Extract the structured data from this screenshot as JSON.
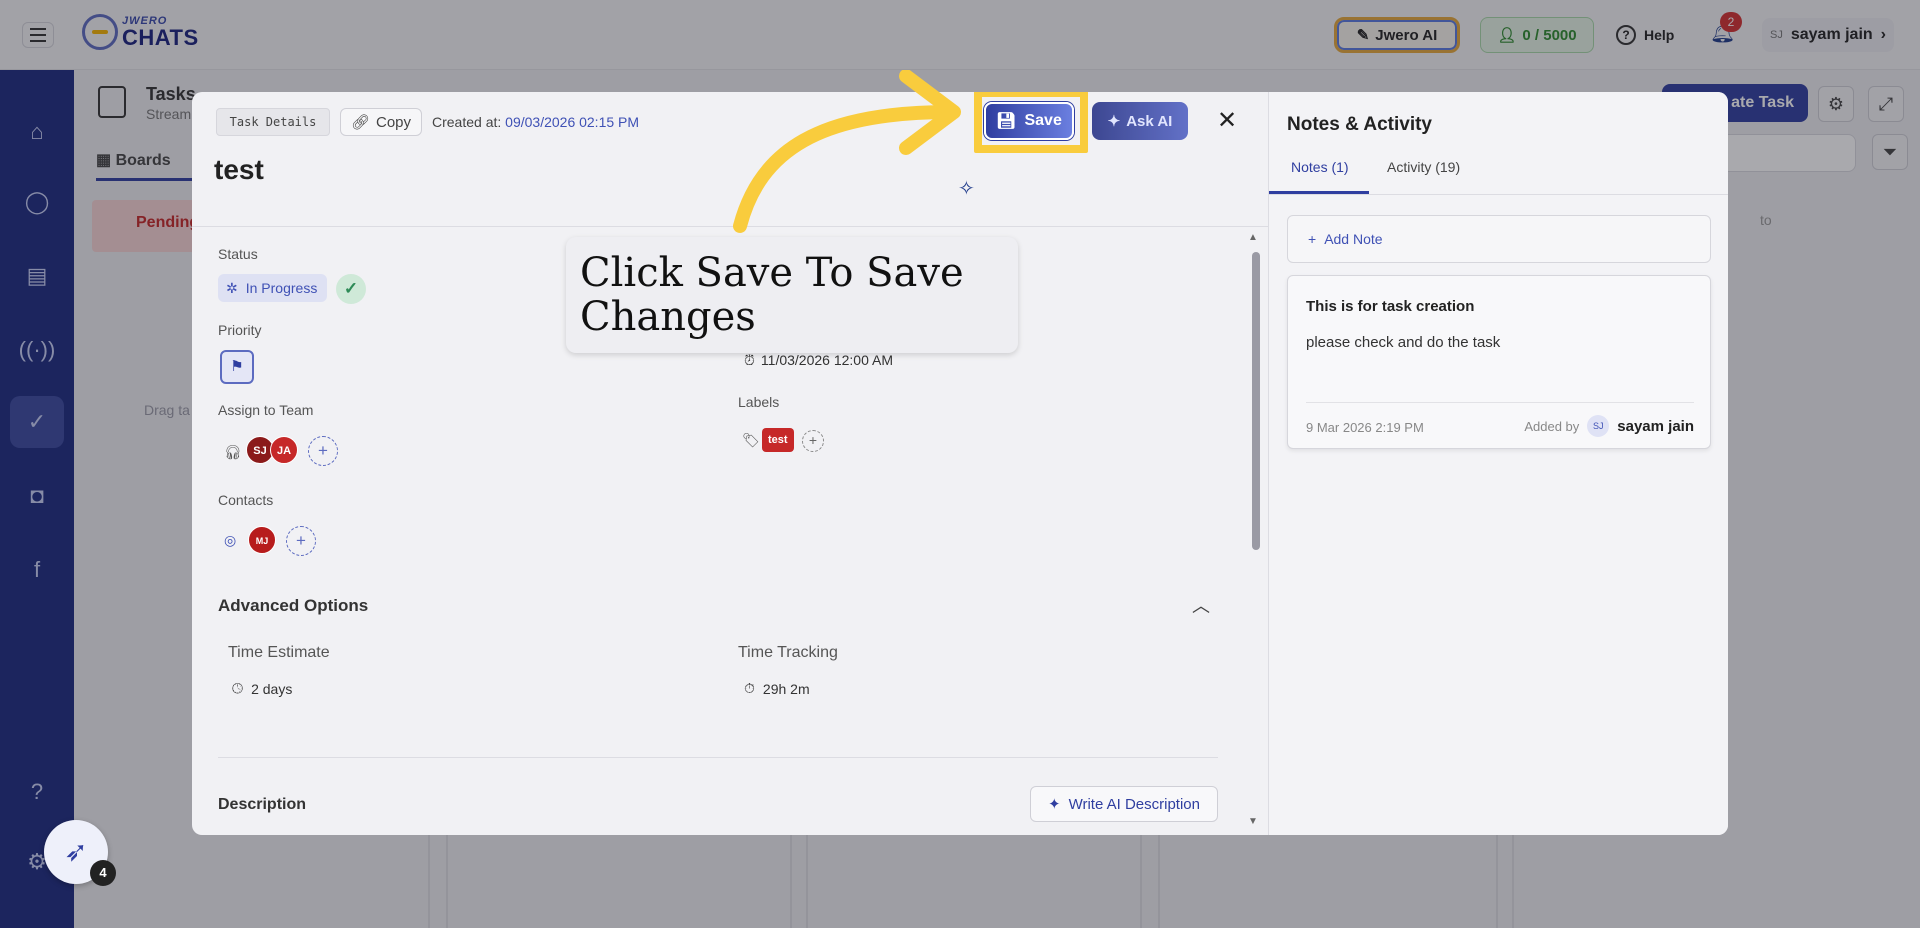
{
  "topbar": {
    "logo_small": "JWERO",
    "logo_big": "CHATS",
    "jwero_ai_label": "Jwero AI",
    "credits_label": "0 / 5000",
    "help_label": "Help",
    "notification_count": "2",
    "user_initials": "SJ",
    "user_name": "sayam jain"
  },
  "page": {
    "title": "Tasks",
    "subtitle": "Stream",
    "boards_tab": "Boards",
    "create_task_label": "ate Task",
    "pending_label": "Pending",
    "drag_hint": "Drag ta",
    "col_hint": "to"
  },
  "launcher": {
    "badge": "4"
  },
  "modal": {
    "task_details_chip": "Task Details",
    "copy_label": "Copy",
    "created_label": "Created at:",
    "created_value": "09/03/2026 02:15 PM",
    "task_title": "test",
    "save_label": "Save",
    "ask_ai_label": "Ask AI",
    "status_label": "Status",
    "status_value": "In Progress",
    "priority_label": "Priority",
    "assign_label": "Assign to Team",
    "assignees": [
      "SJ",
      "JA"
    ],
    "contacts_label": "Contacts",
    "contacts": [
      "MJ"
    ],
    "due_date": "11/03/2026 12:00 AM",
    "labels_label": "Labels",
    "labels": [
      "test"
    ],
    "advanced_title": "Advanced Options",
    "time_estimate_label": "Time Estimate",
    "time_estimate_value": "2 days",
    "time_tracking_label": "Time Tracking",
    "time_tracking_value": "29h 2m",
    "description_title": "Description",
    "write_ai_label": "Write AI Description"
  },
  "notes": {
    "title": "Notes & Activity",
    "tab_notes": "Notes (1)",
    "tab_activity": "Activity (19)",
    "add_note_label": "Add Note",
    "items": [
      {
        "title": "This is for task creation",
        "body": "please check and do the task",
        "date": "9 Mar 2026 2:19 PM",
        "added_by_label": "Added by",
        "author_initials": "SJ",
        "author_name": "sayam jain"
      }
    ]
  },
  "tutorial": {
    "callout_text": "Click Save To Save Changes",
    "highlight_color": "#f9cc3d"
  },
  "colors": {
    "brand": "#2f3ea0",
    "sidebar": "#1c2a80",
    "label_red": "#c62828"
  }
}
